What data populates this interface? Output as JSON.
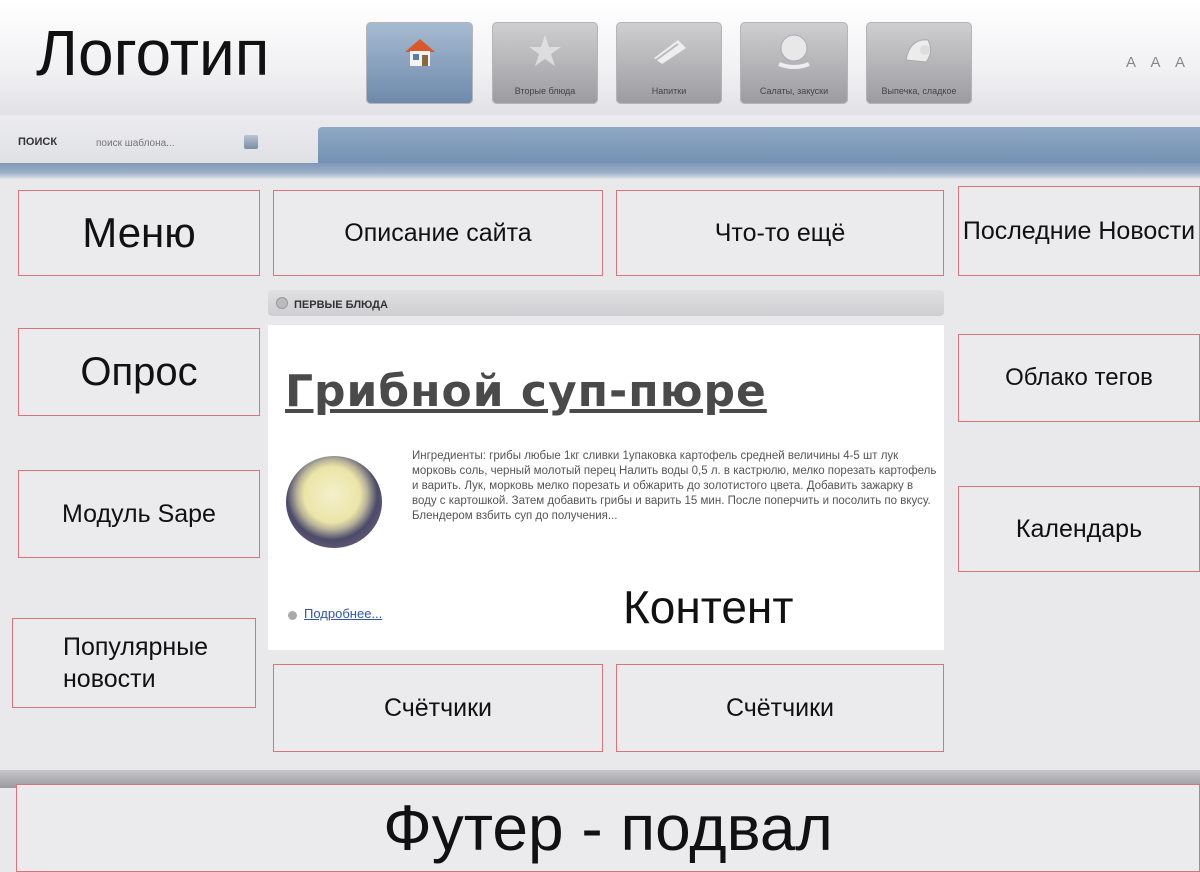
{
  "header": {
    "logo": "Логотип",
    "nav": [
      {
        "label": "",
        "icon": "home-icon"
      },
      {
        "label": "Вторые блюда",
        "icon": "star-icon"
      },
      {
        "label": "Напитки",
        "icon": "drink-icon"
      },
      {
        "label": "Салаты, закуски",
        "icon": "salad-icon"
      },
      {
        "label": "Выпечка, сладкое",
        "icon": "pastry-icon"
      }
    ],
    "font_size_controls": "A A A"
  },
  "search": {
    "label": "ПОИСК",
    "placeholder": "поиск шаблона..."
  },
  "blocks": {
    "menu": "Меню",
    "site_description": "Описание сайта",
    "something_else": "Что-то ещё",
    "latest_news": "Последние Новости",
    "poll": "Опрос",
    "tag_cloud": "Облако тегов",
    "sape_module": "Модуль Sape",
    "calendar": "Календарь",
    "popular_news": "Популярные новости",
    "counters_1": "Счётчики",
    "counters_2": "Счётчики"
  },
  "content": {
    "category": "ПЕРВЫЕ БЛЮДА",
    "title": "Грибной суп-пюре",
    "text": "Ингредиенты: грибы любые 1кг сливки 1упаковка картофель средней величины 4-5 шт лук морковь соль, черный молотый перец Налить воды 0,5 л. в кастрюлю, мелко порезать картофель и варить. Лук, морковь мелко порезать и обжарить до золотистого цвета. Добавить зажарку в воду с картошкой. Затем добавить грибы и варить 15 мин. После поперчить и посолить по вкусу. Блендером взбить суп до получения...",
    "more_link": "Подробнее...",
    "label": "Контент"
  },
  "footer": {
    "label": "Футер - подвал"
  },
  "colors": {
    "accent_blue": "#7491b3",
    "block_border": "#d9737c",
    "background": "#e9e9eb"
  }
}
